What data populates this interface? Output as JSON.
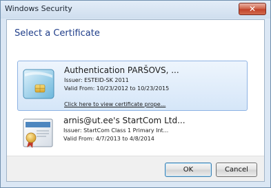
{
  "window": {
    "title": "Windows Security",
    "close_label": "✕"
  },
  "dialog": {
    "heading": "Select a Certificate"
  },
  "certificates": [
    {
      "name": "Authentication PARŠOVS, ...",
      "issuer": "Issuer: ESTEID-SK 2011",
      "valid": "Valid From: 10/23/2012 to 10/23/2015",
      "link": "Click here to view certificate prope...",
      "icon": "smartcard-certificate-icon",
      "selected": true
    },
    {
      "name": "arnis@ut.ee's StartCom Ltd...",
      "issuer": "Issuer: StartCom Class 1 Primary Int...",
      "valid": "Valid From: 4/7/2013 to 4/8/2014",
      "icon": "certificate-icon",
      "selected": false
    }
  ],
  "buttons": {
    "ok": "OK",
    "cancel": "Cancel"
  },
  "colors": {
    "heading": "#1f3d89",
    "selection_border": "#8db2e3",
    "close_button": "#c2432a"
  }
}
